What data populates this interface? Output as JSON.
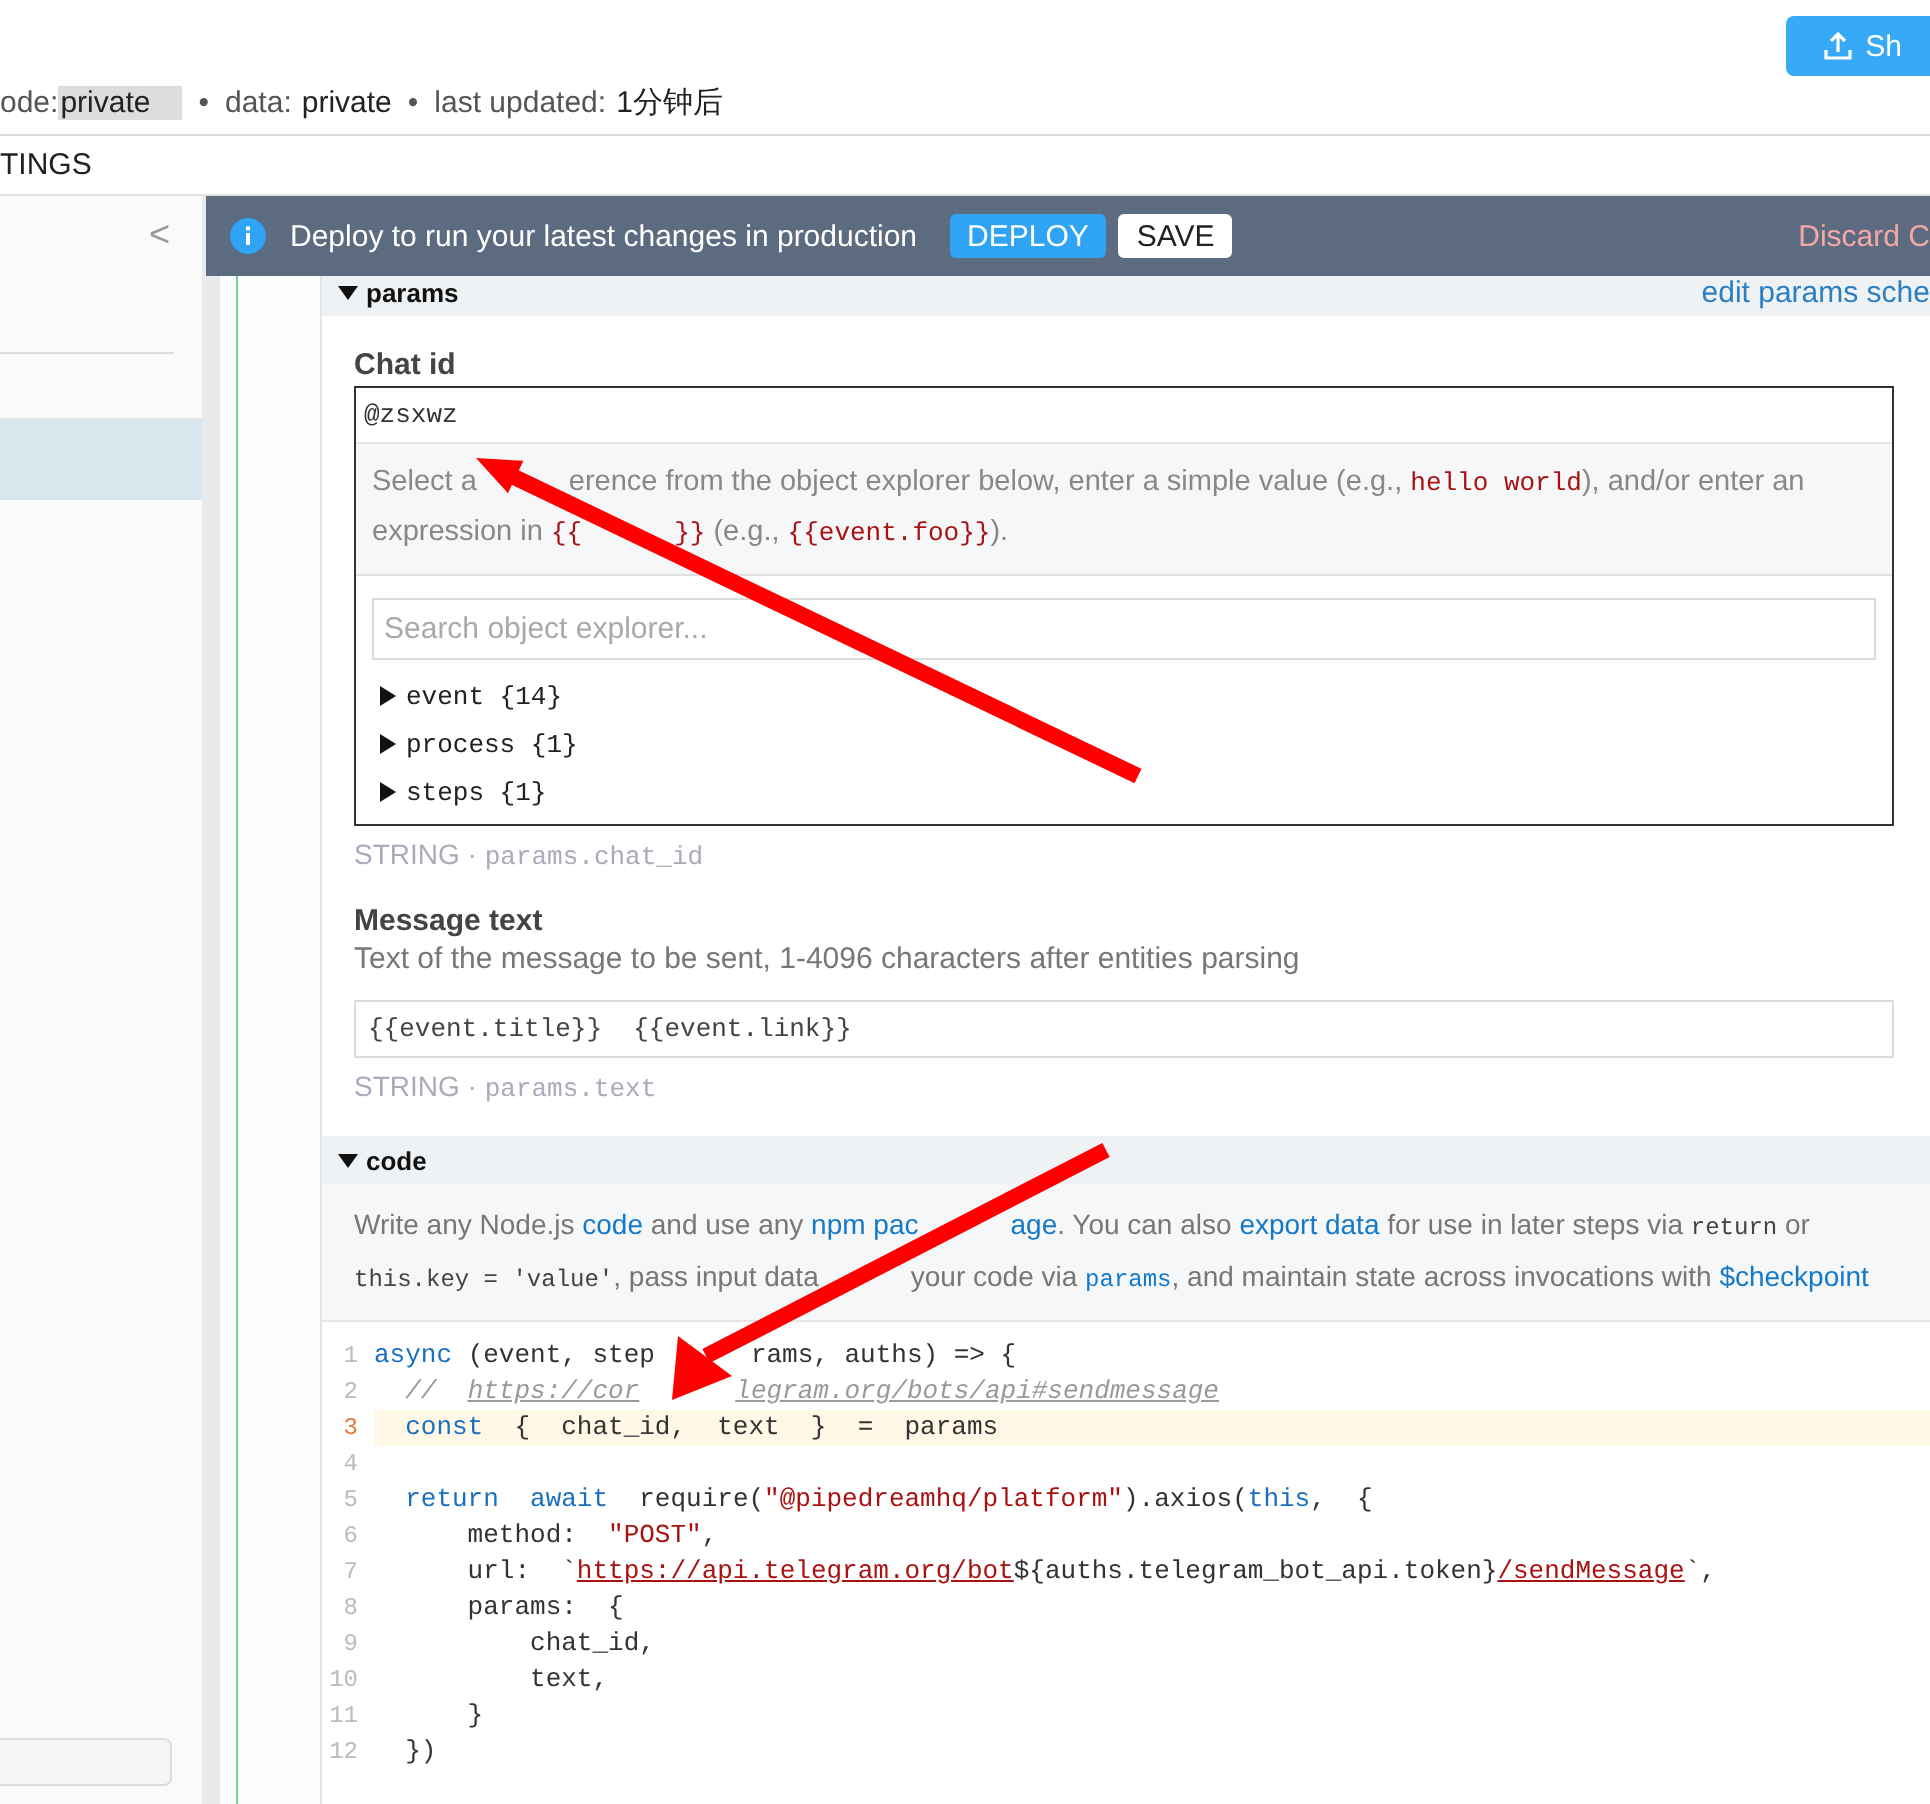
{
  "header": {
    "share_button": "Sh",
    "meta": [
      {
        "label": "ode:",
        "value": "private",
        "boxed": true
      },
      {
        "label": "data:",
        "value": "private",
        "boxed": false
      },
      {
        "label": "last updated:",
        "value": "1分钟后",
        "boxed": false
      }
    ],
    "separator": "•"
  },
  "tab": "TINGS",
  "sidebar": {
    "collapse": "<",
    "selected_row": true
  },
  "banner": {
    "message": "Deploy to run your latest changes in production",
    "deploy": "DEPLOY",
    "save": "SAVE",
    "discard": "Discard C"
  },
  "params": {
    "title": "params",
    "expanded": true,
    "edit_link": "edit params sche",
    "fields": [
      {
        "label": "Chat id",
        "value": "@zsxwz",
        "focused": true,
        "hint": [
          {
            "kind": "text",
            "text": "Select a"
          },
          {
            "kind": "text",
            "gap": true,
            "text": "erence from the object explorer below, enter a simple value (e.g., "
          },
          {
            "kind": "code",
            "text": "hello world"
          },
          {
            "kind": "text",
            "text": "), and/or enter an expression in "
          },
          {
            "kind": "code",
            "text": "{{"
          },
          {
            "kind": "code",
            "gap": true,
            "text": "}}"
          },
          {
            "kind": "text",
            "text": " (e.g., "
          },
          {
            "kind": "code",
            "text": "{{event.foo}}"
          },
          {
            "kind": "text",
            "text": ")."
          }
        ],
        "search_placeholder": "Search object explorer...",
        "tree": [
          {
            "name": "event",
            "count": "{14}",
            "expanded": false
          },
          {
            "name": "process",
            "count": "{1}",
            "expanded": false
          },
          {
            "name": "steps",
            "count": "{1}",
            "expanded": false
          }
        ],
        "type": "STRING ·",
        "path": "params.chat_id"
      },
      {
        "label": "Message text",
        "description": "Text of the message to be sent, 1-4096 characters after entities parsing",
        "value": "{{event.title}}  {{event.link}}",
        "focused": false,
        "type": "STRING ·",
        "path": "params.text"
      }
    ]
  },
  "code": {
    "title": "code",
    "expanded": true,
    "description": [
      {
        "kind": "text",
        "text": "Write any Node.js "
      },
      {
        "kind": "link",
        "text": "code"
      },
      {
        "kind": "text",
        "text": " and use any "
      },
      {
        "kind": "link",
        "text": "npm pac"
      },
      {
        "kind": "link",
        "gap": true,
        "text": "age"
      },
      {
        "kind": "text",
        "text": ". You can also "
      },
      {
        "kind": "link",
        "text": "export data"
      },
      {
        "kind": "text",
        "text": " for use in later steps via "
      },
      {
        "kind": "code",
        "text": "return"
      },
      {
        "kind": "text",
        "text": " or "
      },
      {
        "kind": "code",
        "text": "this.key = 'value'"
      },
      {
        "kind": "text",
        "text": ", pass input data"
      },
      {
        "kind": "text",
        "gap": true,
        "text": "your code via "
      },
      {
        "kind": "linkcode",
        "text": "params"
      },
      {
        "kind": "text",
        "text": ", and maintain state across invocations with "
      },
      {
        "kind": "link",
        "text": "$checkpoint"
      }
    ],
    "lines": [
      {
        "number": "1",
        "current": false,
        "tokens": [
          {
            "kind": "keyword",
            "text": "async"
          },
          {
            "kind": "plain",
            "text": " (event, step"
          },
          {
            "kind": "plain",
            "gap": true,
            "text": "rams, auths) => {"
          }
        ]
      },
      {
        "number": "2",
        "current": false,
        "tokens": [
          {
            "kind": "comment",
            "text": "  //  "
          },
          {
            "kind": "commentlink",
            "text": "https://cor"
          },
          {
            "kind": "commentlink",
            "gap": true,
            "text": "legram.org/bots/api#sendmessage"
          }
        ]
      },
      {
        "number": "3",
        "current": true,
        "tokens": [
          {
            "kind": "keyword",
            "text": "  const"
          },
          {
            "kind": "plain",
            "text": "  {  chat_id,  text  }  =  params"
          }
        ]
      },
      {
        "number": "4",
        "current": false
      },
      {
        "number": "5",
        "current": false,
        "tokens": [
          {
            "kind": "keyword",
            "text": "  return  await"
          },
          {
            "kind": "plain",
            "text": "  require("
          },
          {
            "kind": "string",
            "text": "\"@pipedreamhq/platform\""
          },
          {
            "kind": "plain",
            "text": ").axios("
          },
          {
            "kind": "keyword",
            "text": "this"
          },
          {
            "kind": "plain",
            "text": ",  {"
          }
        ]
      },
      {
        "number": "6",
        "current": false,
        "tokens": [
          {
            "kind": "plain",
            "text": "      method:  "
          },
          {
            "kind": "string",
            "text": "\"POST\""
          },
          {
            "kind": "plain",
            "text": ","
          }
        ]
      },
      {
        "number": "7",
        "current": false,
        "tokens": [
          {
            "kind": "plain",
            "text": "      url:  `"
          },
          {
            "kind": "stringlink",
            "text": "https://api.telegram.org/bot"
          },
          {
            "kind": "plain",
            "text": "${auths.telegram_bot_api.token}"
          },
          {
            "kind": "stringlink",
            "text": "/sendMessage"
          },
          {
            "kind": "plain",
            "text": "`,"
          }
        ]
      },
      {
        "number": "8",
        "current": false,
        "tokens": [
          {
            "kind": "plain",
            "text": "      params:  {"
          }
        ]
      },
      {
        "number": "9",
        "current": false,
        "tokens": [
          {
            "kind": "plain",
            "text": "          chat_id,"
          }
        ]
      },
      {
        "number": "10",
        "current": false,
        "tokens": [
          {
            "kind": "plain",
            "text": "          text,"
          }
        ]
      },
      {
        "number": "11",
        "current": false,
        "tokens": [
          {
            "kind": "plain",
            "text": "      }"
          }
        ]
      },
      {
        "number": "12",
        "current": false,
        "tokens": [
          {
            "kind": "plain",
            "text": "  })"
          }
        ]
      }
    ]
  }
}
